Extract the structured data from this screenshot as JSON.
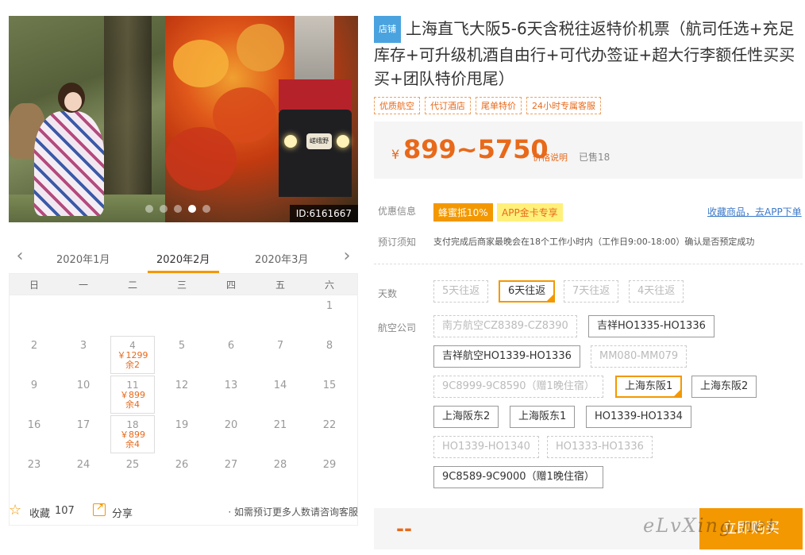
{
  "gallery": {
    "image_id": "ID:6161667",
    "train_plate": "嵯峨野",
    "dots": 5,
    "active_dot": 4
  },
  "calendar": {
    "months": [
      "2020年1月",
      "2020年2月",
      "2020年3月"
    ],
    "active_month": "2020年2月",
    "weekdays": [
      "日",
      "一",
      "二",
      "三",
      "四",
      "五",
      "六"
    ],
    "weeks": [
      [
        null,
        null,
        null,
        null,
        null,
        null,
        {
          "day": "1"
        }
      ],
      [
        {
          "day": "2"
        },
        {
          "day": "3"
        },
        {
          "day": "4",
          "price": "￥1299",
          "stock": "余2"
        },
        {
          "day": "5"
        },
        {
          "day": "6"
        },
        {
          "day": "7"
        },
        {
          "day": "8"
        }
      ],
      [
        {
          "day": "9"
        },
        {
          "day": "10"
        },
        {
          "day": "11",
          "price": "￥899",
          "stock": "余4"
        },
        {
          "day": "12"
        },
        {
          "day": "13"
        },
        {
          "day": "14"
        },
        {
          "day": "15"
        }
      ],
      [
        {
          "day": "16"
        },
        {
          "day": "17"
        },
        {
          "day": "18",
          "price": "￥899",
          "stock": "余4"
        },
        {
          "day": "19"
        },
        {
          "day": "20"
        },
        {
          "day": "21"
        },
        {
          "day": "22"
        }
      ],
      [
        {
          "day": "23"
        },
        {
          "day": "24"
        },
        {
          "day": "25"
        },
        {
          "day": "26"
        },
        {
          "day": "27"
        },
        {
          "day": "28"
        },
        {
          "day": "29"
        }
      ]
    ]
  },
  "actions": {
    "favorite_label": "收藏",
    "favorite_count": "107",
    "share_label": "分享",
    "consult_text": "· 如需预订更多人数请咨询客服"
  },
  "product": {
    "shop_tag": "店铺",
    "title": "上海直飞大阪5-6天含税往返特价机票（航司任选+充足库存+可升级机酒自由行+可代办签证+超大行李额任性买买买+团队特价甩尾）",
    "badges": [
      "优质航空",
      "代订酒店",
      "尾单特价",
      "24小时专属客服"
    ],
    "currency": "¥",
    "price_range": "899~5750",
    "price_note": "价格说明",
    "sold": "已售18"
  },
  "promo": {
    "label": "优惠信息",
    "tags": [
      "蜂蜜抵10%",
      "APP金卡专享"
    ],
    "app_link": "收藏商品，去APP下单"
  },
  "booking": {
    "label": "预订须知",
    "text": "支付完成后商家最晚会在18个工作小时内（工作日9:00-18:00）确认是否预定成功"
  },
  "options": {
    "days_label": "天数",
    "days": [
      {
        "label": "5天往返",
        "state": "disabled"
      },
      {
        "label": "6天往返",
        "state": "selected"
      },
      {
        "label": "7天往返",
        "state": "disabled"
      },
      {
        "label": "4天往返",
        "state": "disabled"
      }
    ],
    "airline_label": "航空公司",
    "airlines": [
      {
        "label": "南方航空CZ8389-CZ8390",
        "state": "disabled"
      },
      {
        "label": "吉祥HO1335-HO1336",
        "state": "normal"
      },
      {
        "label": "吉祥航空HO1339-HO1336",
        "state": "normal"
      },
      {
        "label": "MM080-MM079",
        "state": "disabled"
      },
      {
        "label": "9C8999-9C8590（赠1晚住宿）",
        "state": "disabled"
      },
      {
        "label": "上海东阪1",
        "state": "selected"
      },
      {
        "label": "上海东阪2",
        "state": "normal"
      },
      {
        "label": "上海阪东2",
        "state": "normal"
      },
      {
        "label": "上海阪东1",
        "state": "normal"
      },
      {
        "label": "HO1339-HO1334",
        "state": "normal"
      },
      {
        "label": "HO1339-HO1340",
        "state": "disabled"
      },
      {
        "label": "HO1333-HO1336",
        "state": "disabled"
      },
      {
        "label": "9C8589-9C9000（赠1晚住宿）",
        "state": "normal"
      }
    ]
  },
  "buy": {
    "price_placeholder": "--",
    "button": "立即购买",
    "watermark": "eLvXing.net"
  },
  "colors": {
    "accent": "#f39800",
    "price": "#e8691a",
    "link": "#3d7ac9"
  }
}
